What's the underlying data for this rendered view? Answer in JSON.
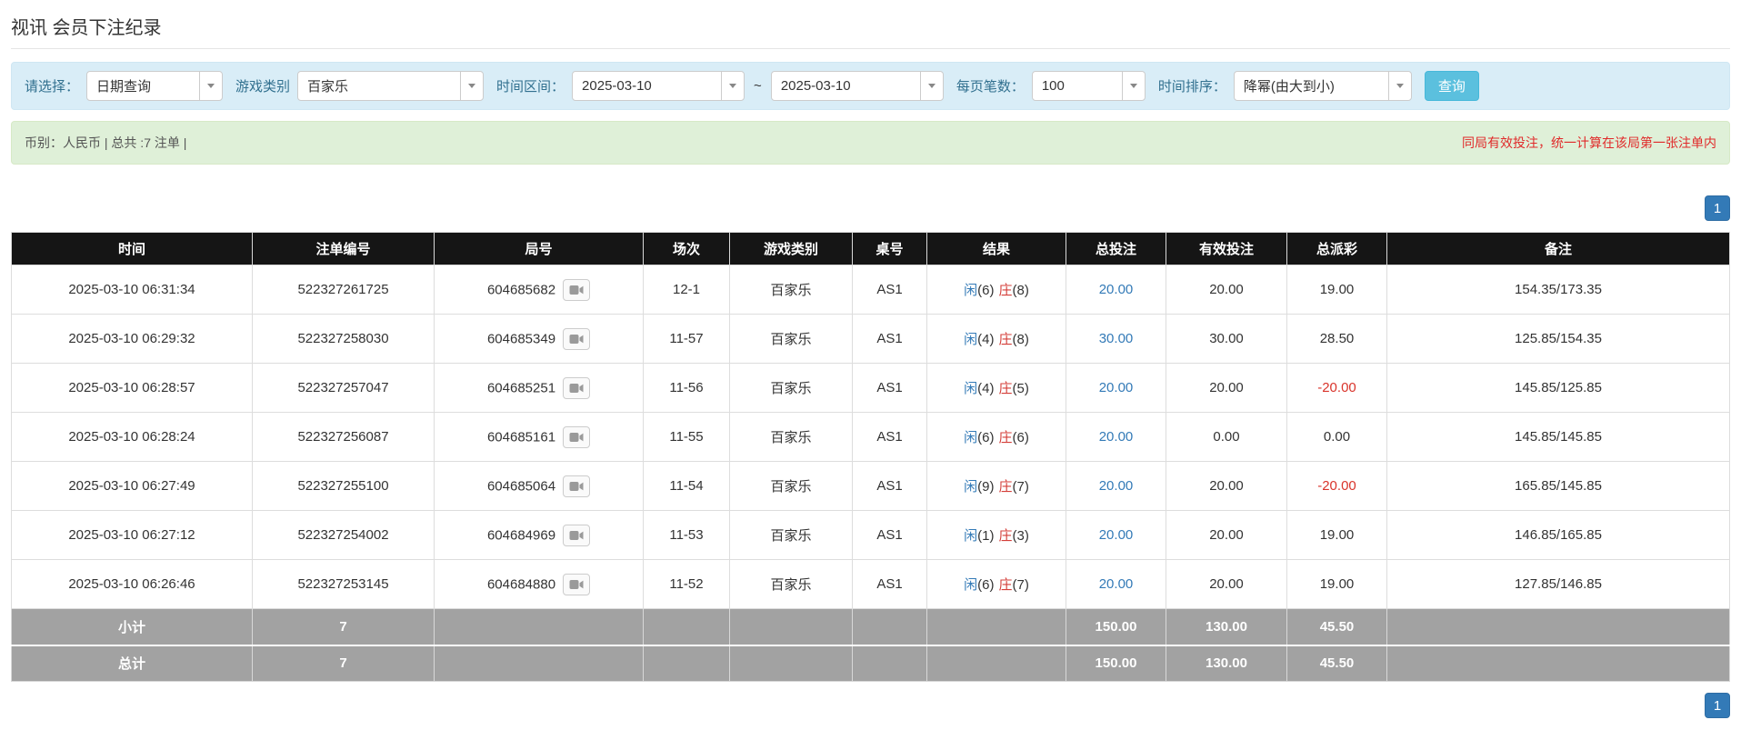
{
  "page": {
    "title": "视讯 会员下注纪录"
  },
  "filters": {
    "select_label": "请选择：",
    "select_value": "日期查询",
    "game_type_label": "游戏类别",
    "game_type_value": "百家乐",
    "range_label": "时间区间：",
    "date_from": "2025-03-10",
    "tilde": "~",
    "date_to": "2025-03-10",
    "page_size_label": "每页笔数：",
    "page_size_value": "100",
    "sort_label": "时间排序：",
    "sort_value": "降幂(由大到小)",
    "search_button": "查询"
  },
  "summary": {
    "left": "币别：人民币 | 总共 :7 注单 |",
    "right": "同局有效投注，统一计算在该局第一张注单内"
  },
  "pagination": {
    "page": "1"
  },
  "table": {
    "headers": [
      "时间",
      "注单编号",
      "局号",
      "场次",
      "游戏类别",
      "桌号",
      "结果",
      "总投注",
      "有效投注",
      "总派彩",
      "备注"
    ],
    "rows": [
      {
        "time": "2025-03-10 06:31:34",
        "bet_id": "522327261725",
        "round_id": "604685682",
        "session": "12-1",
        "game_type": "百家乐",
        "table_no": "AS1",
        "result": {
          "p_label": "闲",
          "p_val": "(6)",
          "b_label": "庄",
          "b_val": "(8)"
        },
        "total_bet": "20.00",
        "valid_bet": "20.00",
        "payout": "19.00",
        "note": "154.35/173.35"
      },
      {
        "time": "2025-03-10 06:29:32",
        "bet_id": "522327258030",
        "round_id": "604685349",
        "session": "11-57",
        "game_type": "百家乐",
        "table_no": "AS1",
        "result": {
          "p_label": "闲",
          "p_val": "(4)",
          "b_label": "庄",
          "b_val": "(8)"
        },
        "total_bet": "30.00",
        "valid_bet": "30.00",
        "payout": "28.50",
        "note": "125.85/154.35"
      },
      {
        "time": "2025-03-10 06:28:57",
        "bet_id": "522327257047",
        "round_id": "604685251",
        "session": "11-56",
        "game_type": "百家乐",
        "table_no": "AS1",
        "result": {
          "p_label": "闲",
          "p_val": "(4)",
          "b_label": "庄",
          "b_val": "(5)"
        },
        "total_bet": "20.00",
        "valid_bet": "20.00",
        "payout": "-20.00",
        "note": "145.85/125.85"
      },
      {
        "time": "2025-03-10 06:28:24",
        "bet_id": "522327256087",
        "round_id": "604685161",
        "session": "11-55",
        "game_type": "百家乐",
        "table_no": "AS1",
        "result": {
          "p_label": "闲",
          "p_val": "(6)",
          "b_label": "庄",
          "b_val": "(6)"
        },
        "total_bet": "20.00",
        "valid_bet": "0.00",
        "payout": "0.00",
        "note": "145.85/145.85"
      },
      {
        "time": "2025-03-10 06:27:49",
        "bet_id": "522327255100",
        "round_id": "604685064",
        "session": "11-54",
        "game_type": "百家乐",
        "table_no": "AS1",
        "result": {
          "p_label": "闲",
          "p_val": "(9)",
          "b_label": "庄",
          "b_val": "(7)"
        },
        "total_bet": "20.00",
        "valid_bet": "20.00",
        "payout": "-20.00",
        "note": "165.85/145.85"
      },
      {
        "time": "2025-03-10 06:27:12",
        "bet_id": "522327254002",
        "round_id": "604684969",
        "session": "11-53",
        "game_type": "百家乐",
        "table_no": "AS1",
        "result": {
          "p_label": "闲",
          "p_val": "(1)",
          "b_label": "庄",
          "b_val": "(3)"
        },
        "total_bet": "20.00",
        "valid_bet": "20.00",
        "payout": "19.00",
        "note": "146.85/165.85"
      },
      {
        "time": "2025-03-10 06:26:46",
        "bet_id": "522327253145",
        "round_id": "604684880",
        "session": "11-52",
        "game_type": "百家乐",
        "table_no": "AS1",
        "result": {
          "p_label": "闲",
          "p_val": "(6)",
          "b_label": "庄",
          "b_val": "(7)"
        },
        "total_bet": "20.00",
        "valid_bet": "20.00",
        "payout": "19.00",
        "note": "127.85/146.85"
      }
    ],
    "subtotal": {
      "label": "小计",
      "count": "7",
      "total_bet": "150.00",
      "valid_bet": "130.00",
      "payout": "45.50"
    },
    "total": {
      "label": "总计",
      "count": "7",
      "total_bet": "150.00",
      "valid_bet": "130.00",
      "payout": "45.50"
    }
  },
  "colors": {
    "filter_bg": "#d9edf7",
    "filter_label": "#31708f",
    "summary_bg": "#dff0d8",
    "notice_red": "#e02a2a",
    "header_bg": "#151515",
    "footer_bg": "#a2a2a2",
    "search_btn": "#5bc0de",
    "pager_bg": "#337ab7",
    "link_blue": "#337ab7",
    "player_blue": "#337ab7",
    "banker_red": "#d43f3a",
    "negative_red": "#d9342b"
  }
}
